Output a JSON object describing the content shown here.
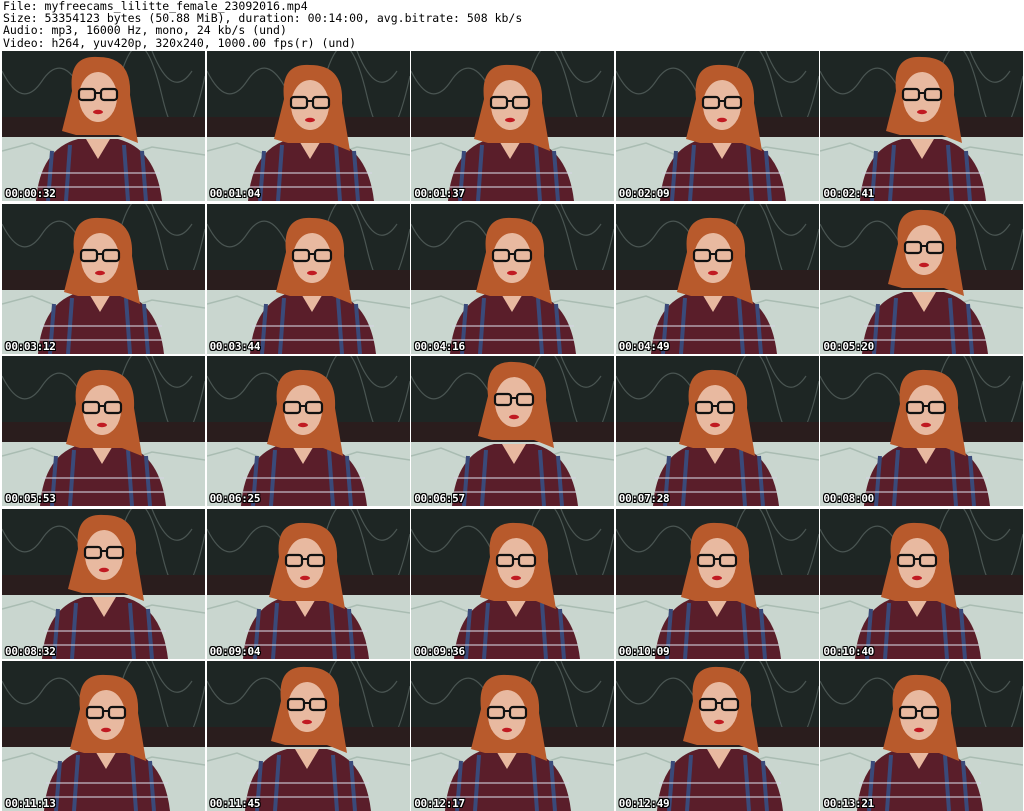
{
  "header": {
    "line1": "File: myfreecams_lilitte_female_23092016.mp4",
    "line2": "Size: 53354123 bytes (50.88 MiB), duration: 00:14:00, avg.bitrate: 508 kb/s",
    "line3": "Audio: mp3, 16000 Hz, mono, 24 kb/s (und)",
    "line4": "Video: h264, yuv420p, 320x240, 1000.00 fps(r) (und)"
  },
  "frames": [
    {
      "timestamp": "00:00:32",
      "pose": "center"
    },
    {
      "timestamp": "00:01:04",
      "pose": "down"
    },
    {
      "timestamp": "00:01:37",
      "pose": "down"
    },
    {
      "timestamp": "00:02:09",
      "pose": "down"
    },
    {
      "timestamp": "00:02:41",
      "pose": "center"
    },
    {
      "timestamp": "00:03:12",
      "pose": "down"
    },
    {
      "timestamp": "00:03:44",
      "pose": "down"
    },
    {
      "timestamp": "00:04:16",
      "pose": "down"
    },
    {
      "timestamp": "00:04:49",
      "pose": "down"
    },
    {
      "timestamp": "00:05:20",
      "pose": "center"
    },
    {
      "timestamp": "00:05:53",
      "pose": "down"
    },
    {
      "timestamp": "00:06:25",
      "pose": "down"
    },
    {
      "timestamp": "00:06:57",
      "pose": "center"
    },
    {
      "timestamp": "00:07:28",
      "pose": "down"
    },
    {
      "timestamp": "00:08:00",
      "pose": "down"
    },
    {
      "timestamp": "00:08:32",
      "pose": "center"
    },
    {
      "timestamp": "00:09:04",
      "pose": "down"
    },
    {
      "timestamp": "00:09:36",
      "pose": "down"
    },
    {
      "timestamp": "00:10:09",
      "pose": "down"
    },
    {
      "timestamp": "00:10:40",
      "pose": "down"
    },
    {
      "timestamp": "00:11:13",
      "pose": "down"
    },
    {
      "timestamp": "00:11:45",
      "pose": "center"
    },
    {
      "timestamp": "00:12:17",
      "pose": "down"
    },
    {
      "timestamp": "00:12:49",
      "pose": "center"
    },
    {
      "timestamp": "00:13:21",
      "pose": "down"
    }
  ],
  "colors": {
    "wall": "#1e2624",
    "headboard": "#2a1d1d",
    "bedding": "#c9d6cf",
    "hair": "#b85a2c",
    "skin": "#e8b9a0",
    "shirt": "#5a1e2a",
    "plaid": "#3a4a7a",
    "glasses": "#111111",
    "lips": "#c01a22"
  }
}
